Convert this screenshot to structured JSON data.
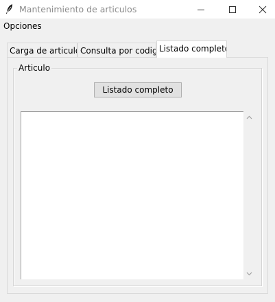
{
  "window": {
    "title": "Mantenimiento de articulos",
    "icon": "feather-icon"
  },
  "menubar": {
    "items": [
      {
        "label": "Opciones"
      }
    ]
  },
  "tabs": [
    {
      "label": "Carga de articulos",
      "active": false
    },
    {
      "label": "Consulta por codigo",
      "active": false
    },
    {
      "label": "Listado completo",
      "active": true
    }
  ],
  "frame": {
    "label": "Articulo"
  },
  "main": {
    "listado_button": "Listado completo",
    "text_content": ""
  }
}
